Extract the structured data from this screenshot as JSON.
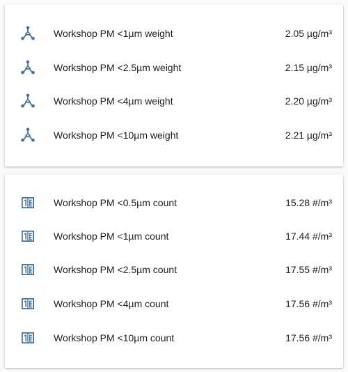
{
  "colors": {
    "icon": "#44739e",
    "text": "#212121",
    "card": "#ffffff",
    "background": "#fafafa"
  },
  "weight_card": {
    "icon": "molecule-icon",
    "rows": [
      {
        "label": "Workshop PM <1µm weight",
        "value": "2.05 µg/m³"
      },
      {
        "label": "Workshop PM <2.5µm weight",
        "value": "2.15 µg/m³"
      },
      {
        "label": "Workshop PM <4µm weight",
        "value": "2.20 µg/m³"
      },
      {
        "label": "Workshop PM <10µm weight",
        "value": "2.21 µg/m³"
      }
    ]
  },
  "count_card": {
    "icon": "counter-icon",
    "rows": [
      {
        "label": "Workshop PM <0.5µm count",
        "value": "15.28 #/m³"
      },
      {
        "label": "Workshop PM <1µm count",
        "value": "17.44 #/m³"
      },
      {
        "label": "Workshop PM <2.5µm count",
        "value": "17.55 #/m³"
      },
      {
        "label": "Workshop PM <4µm count",
        "value": "17.56 #/m³"
      },
      {
        "label": "Workshop PM <10µm count",
        "value": "17.56 #/m³"
      }
    ]
  }
}
